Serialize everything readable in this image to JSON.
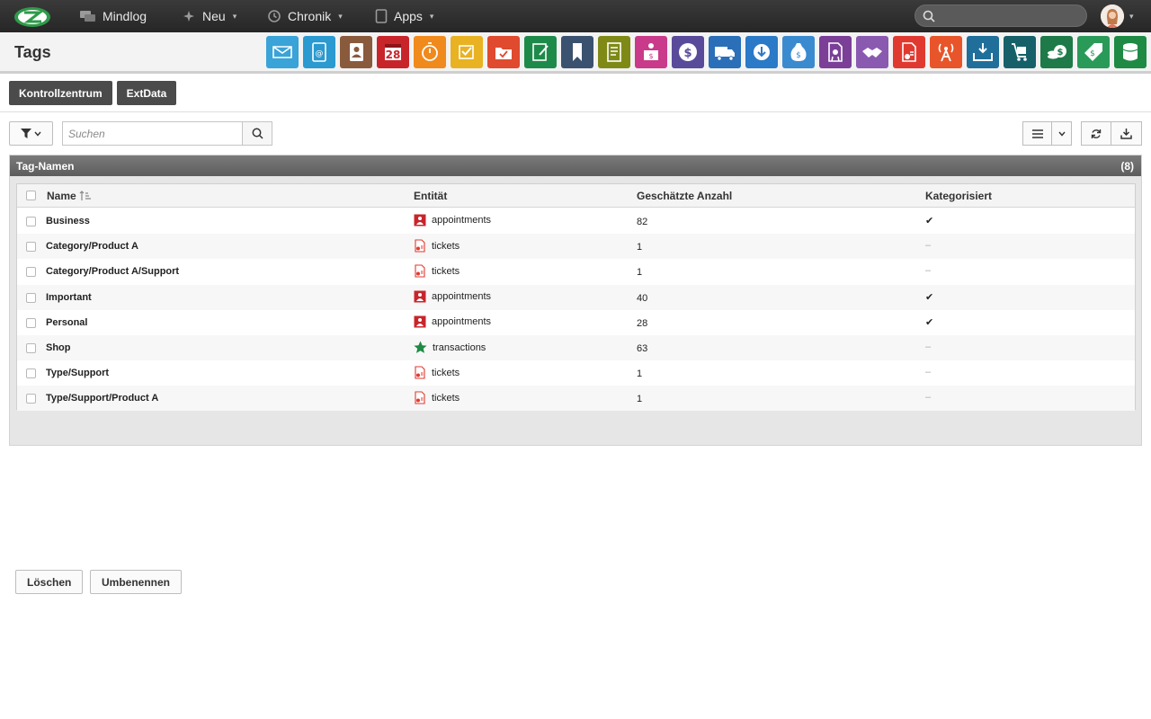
{
  "nav": {
    "brand": "Mindlog",
    "items": [
      {
        "label": "Neu",
        "icon": "sparkle-icon"
      },
      {
        "label": "Chronik",
        "icon": "history-icon"
      },
      {
        "label": "Apps",
        "icon": "tablet-icon"
      }
    ],
    "search_placeholder": ""
  },
  "header": {
    "title": "Tags",
    "apps": [
      {
        "name": "mail-icon",
        "color": "#3aa3d8"
      },
      {
        "name": "address-book-icon",
        "color": "#2a9ad0"
      },
      {
        "name": "contacts-icon",
        "color": "#8a5a3c"
      },
      {
        "name": "calendar-icon",
        "color": "#c8252b",
        "text": "28"
      },
      {
        "name": "timer-icon",
        "color": "#f08a1c"
      },
      {
        "name": "tasks-icon",
        "color": "#e8b222"
      },
      {
        "name": "projects-icon",
        "color": "#e04a2e"
      },
      {
        "name": "notes-icon",
        "color": "#1e8a4a"
      },
      {
        "name": "bookmark-icon",
        "color": "#3b5170"
      },
      {
        "name": "documents-icon",
        "color": "#7f8a16"
      },
      {
        "name": "sales-desk-icon",
        "color": "#c93a8a"
      },
      {
        "name": "money-icon",
        "color": "#5a4a9a"
      },
      {
        "name": "delivery-truck-icon",
        "color": "#2a6fb8"
      },
      {
        "name": "purchase-icon",
        "color": "#2a7ac8"
      },
      {
        "name": "money-bag-icon",
        "color": "#3a8ad0"
      },
      {
        "name": "contract-icon",
        "color": "#7b3f98"
      },
      {
        "name": "handshake-icon",
        "color": "#8a5ab0"
      },
      {
        "name": "tickets-icon",
        "color": "#e03a30"
      },
      {
        "name": "broadcast-icon",
        "color": "#e8552a"
      },
      {
        "name": "inbox-download-icon",
        "color": "#1f6f9a"
      },
      {
        "name": "cart-icon",
        "color": "#16606a"
      },
      {
        "name": "cash-icon",
        "color": "#1e7a48"
      },
      {
        "name": "price-tag-icon",
        "color": "#2a9a58"
      },
      {
        "name": "database-icon",
        "color": "#1e8a44"
      }
    ]
  },
  "breadcrumbs": [
    "Kontrollzentrum",
    "ExtData"
  ],
  "toolbar": {
    "search_placeholder": "Suchen"
  },
  "panel": {
    "title": "Tag-Namen",
    "count": "(8)",
    "columns": {
      "name": "Name",
      "entity": "Entität",
      "estimate": "Geschätzte Anzahl",
      "categorized": "Kategorisiert"
    },
    "rows": [
      {
        "name": "Business",
        "entity": "appointments",
        "entity_icon": "appointments-icon",
        "estimate": "82",
        "categorized": "✔"
      },
      {
        "name": "Category/Product A",
        "entity": "tickets",
        "entity_icon": "tickets-icon",
        "estimate": "1",
        "categorized": "–"
      },
      {
        "name": "Category/Product A/Support",
        "entity": "tickets",
        "entity_icon": "tickets-icon",
        "estimate": "1",
        "categorized": "–"
      },
      {
        "name": "Important",
        "entity": "appointments",
        "entity_icon": "appointments-icon",
        "estimate": "40",
        "categorized": "✔"
      },
      {
        "name": "Personal",
        "entity": "appointments",
        "entity_icon": "appointments-icon",
        "estimate": "28",
        "categorized": "✔"
      },
      {
        "name": "Shop",
        "entity": "transactions",
        "entity_icon": "star-icon",
        "estimate": "63",
        "categorized": "–"
      },
      {
        "name": "Type/Support",
        "entity": "tickets",
        "entity_icon": "tickets-icon",
        "estimate": "1",
        "categorized": "–"
      },
      {
        "name": "Type/Support/Product A",
        "entity": "tickets",
        "entity_icon": "tickets-icon",
        "estimate": "1",
        "categorized": "–"
      }
    ],
    "buttons": {
      "delete": "Löschen",
      "rename": "Umbenennen"
    }
  }
}
